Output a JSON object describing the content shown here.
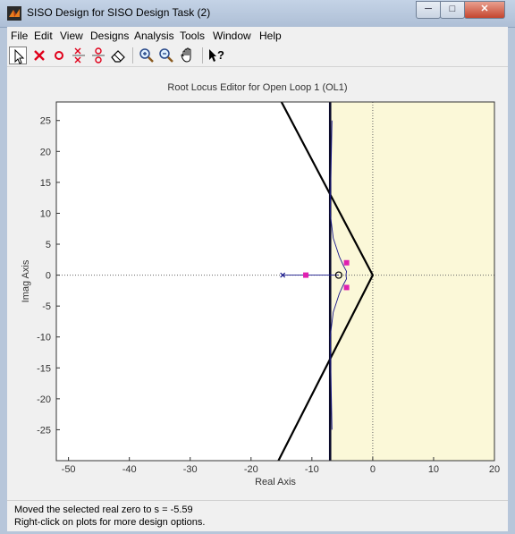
{
  "window": {
    "title": "SISO Design for SISO Design Task (2)",
    "minimize": "─",
    "maximize": "□",
    "close": "✕"
  },
  "menu": [
    "File",
    "Edit",
    "View",
    "Designs",
    "Analysis",
    "Tools",
    "Window",
    "Help"
  ],
  "toolbar": {
    "tools": [
      "select-arrow-icon",
      "add-real-pole-icon",
      "add-real-zero-icon",
      "add-complex-pole-icon",
      "add-complex-zero-icon",
      "eraser-icon",
      "zoom-in-icon",
      "zoom-out-icon",
      "pan-hand-icon",
      "whats-this-help-icon"
    ]
  },
  "plot": {
    "title": "Root Locus Editor for Open Loop 1 (OL1)",
    "xlabel": "Real Axis",
    "ylabel": "Imag Axis"
  },
  "chart_data": {
    "type": "scatter",
    "title": "Root Locus Editor for Open Loop 1 (OL1)",
    "xlabel": "Real Axis",
    "ylabel": "Imag Axis",
    "xlim": [
      -52,
      20
    ],
    "ylim": [
      -30,
      28
    ],
    "xticks": [
      -50,
      -40,
      -30,
      -20,
      -10,
      0,
      10,
      20
    ],
    "yticks": [
      25,
      20,
      15,
      10,
      5,
      0,
      -5,
      -10,
      -15,
      -20,
      -25
    ],
    "grid": false,
    "colors": {
      "background": "#ffffff",
      "unstable_region": "#fbf8d8",
      "axis": "#000000",
      "locus": "#1a1a8c",
      "closed_loop_pole": "#e020b0",
      "constraint": "#000000"
    },
    "open_loop_poles": [
      [
        -14.8,
        0
      ]
    ],
    "open_loop_zeros": [
      [
        -5.59,
        0
      ]
    ],
    "closed_loop_poles": [
      [
        -11,
        0
      ],
      [
        -4.3,
        2
      ],
      [
        -4.3,
        -2
      ]
    ],
    "constraints": {
      "real_part_bound": -7,
      "damping_wedge": [
        [
          -15,
          28
        ],
        [
          0,
          0
        ],
        [
          -15.5,
          -30
        ]
      ]
    },
    "locus_branches": [
      [
        [
          -14.8,
          0
        ],
        [
          -5.59,
          0
        ]
      ],
      [
        [
          -6.7,
          25
        ],
        [
          -7,
          10
        ],
        [
          -6.5,
          6
        ],
        [
          -5.5,
          3
        ],
        [
          -4.8,
          1.5
        ],
        [
          -4.3,
          0.6
        ],
        [
          -4.4,
          0
        ],
        [
          -4.3,
          -0.6
        ],
        [
          -4.8,
          -1.5
        ],
        [
          -5.5,
          -3
        ],
        [
          -6.5,
          -6
        ],
        [
          -7,
          -10
        ],
        [
          -6.7,
          -25
        ]
      ]
    ]
  },
  "status": {
    "line1": "Moved the selected real zero to s = -5.59",
    "line2": "Right-click on plots for more design options."
  }
}
